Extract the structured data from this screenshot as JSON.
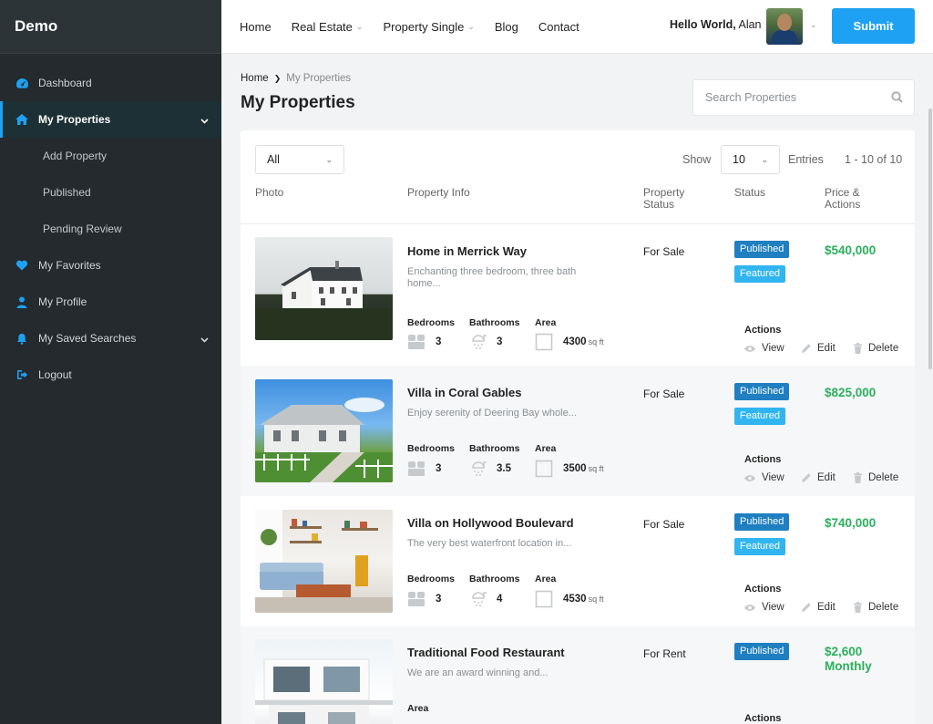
{
  "brand": "Demo",
  "sidebar": {
    "items": [
      {
        "label": "Dashboard",
        "icon": "dashboard-icon"
      },
      {
        "label": "My Properties",
        "icon": "home-icon",
        "active": true
      },
      {
        "label": "Add Property"
      },
      {
        "label": "Published"
      },
      {
        "label": "Pending Review"
      },
      {
        "label": "My Favorites",
        "icon": "heart-icon"
      },
      {
        "label": "My Profile",
        "icon": "user-icon"
      },
      {
        "label": "My Saved Searches",
        "icon": "bell-icon"
      },
      {
        "label": "Logout",
        "icon": "logout-icon"
      }
    ]
  },
  "topnav": {
    "home": "Home",
    "real_estate": "Real Estate",
    "property_single": "Property Single",
    "blog": "Blog",
    "contact": "Contact",
    "hello_prefix": "Hello World,",
    "hello_name": "Alan",
    "submit": "Submit"
  },
  "breadcrumb": {
    "home": "Home",
    "current": "My Properties"
  },
  "page_title": "My Properties",
  "search": {
    "placeholder": "Search Properties"
  },
  "table": {
    "filter": "All",
    "show_label": "Show",
    "show_value": "10",
    "entries_label": "Entries",
    "range": "1 - 10 of 10",
    "headers": {
      "photo": "Photo",
      "info": "Property Info",
      "pstatus_1": "Property",
      "pstatus_2": "Status",
      "status": "Status",
      "price_1": "Price &",
      "price_2": "Actions"
    },
    "labels": {
      "bedrooms": "Bedrooms",
      "bathrooms": "Bathrooms",
      "area": "Area",
      "sqft": "sq ft",
      "actions": "Actions",
      "view": "View",
      "edit": "Edit",
      "delete": "Delete",
      "published": "Published",
      "featured": "Featured"
    },
    "rows": [
      {
        "title": "Home in Merrick Way",
        "desc": "Enchanting three bedroom, three bath home...",
        "bedrooms": "3",
        "bathrooms": "3",
        "area": "4300",
        "pstatus": "For Sale",
        "price": "$540,000"
      },
      {
        "title": "Villa in Coral Gables",
        "desc": "Enjoy serenity of Deering Bay whole...",
        "bedrooms": "3",
        "bathrooms": "3.5",
        "area": "3500",
        "pstatus": "For Sale",
        "price": "$825,000"
      },
      {
        "title": "Villa on Hollywood Boulevard",
        "desc": "The very best waterfront location in...",
        "bedrooms": "3",
        "bathrooms": "4",
        "area": "4530",
        "pstatus": "For Sale",
        "price": "$740,000"
      },
      {
        "title": "Traditional Food Restaurant",
        "desc": "We are an award winning and...",
        "pstatus": "For Rent",
        "price": "$2,600",
        "price_suffix": "Monthly"
      }
    ]
  },
  "colors": {
    "accent": "#1ea1f2",
    "sidebar": "#242a2e",
    "price": "#2bb05c",
    "published": "#1f7fc1",
    "featured": "#31b5f0"
  }
}
